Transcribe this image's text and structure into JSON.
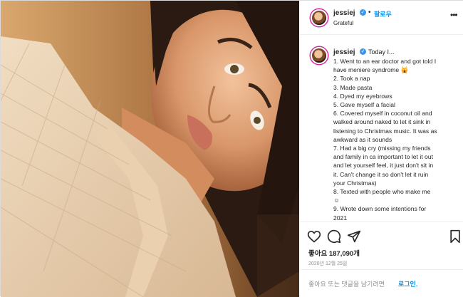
{
  "header": {
    "username": "jessiej",
    "dot": "•",
    "follow_label": "팔로우",
    "location": "Grateful",
    "more_icon": "more-horizontal-icon"
  },
  "caption": {
    "username": "jessiej",
    "title": "Today I...",
    "lines": [
      "1. Went to an ear doctor and got told I",
      "have meniere syndrome 🙀",
      "2. Took a nap",
      "3. Made pasta",
      "4. Dyed my eyebrows",
      "5. Gave myself a facial",
      "6. Covered myself in coconut oil and",
      "walked around naked to let it sink in",
      "listening to Christmas music. It was as",
      "awkward as it sounds",
      "7. Had a big cry (missing my friends",
      "and family in ca important to let it out",
      "and let yourself feel, it just don't sit in",
      "it. Can't change it so don't let it ruin",
      "your Christmas)",
      "8. Texted with people who make me",
      "☺",
      "9. Wrote down some intentions for",
      "2021"
    ]
  },
  "actions": {
    "icons": [
      "heart-icon",
      "comment-icon",
      "share-icon",
      "bookmark-icon"
    ],
    "likes": "좋아요 187,090개",
    "date": "2020년 12월 25일"
  },
  "login": {
    "prompt": "좋아요 또는 댓글을 남기려면",
    "link": "로그인."
  },
  "colors": {
    "link_blue": "#0095f6",
    "verified_blue": "#3897f0",
    "text": "#262626",
    "muted": "#8e8e8e"
  }
}
